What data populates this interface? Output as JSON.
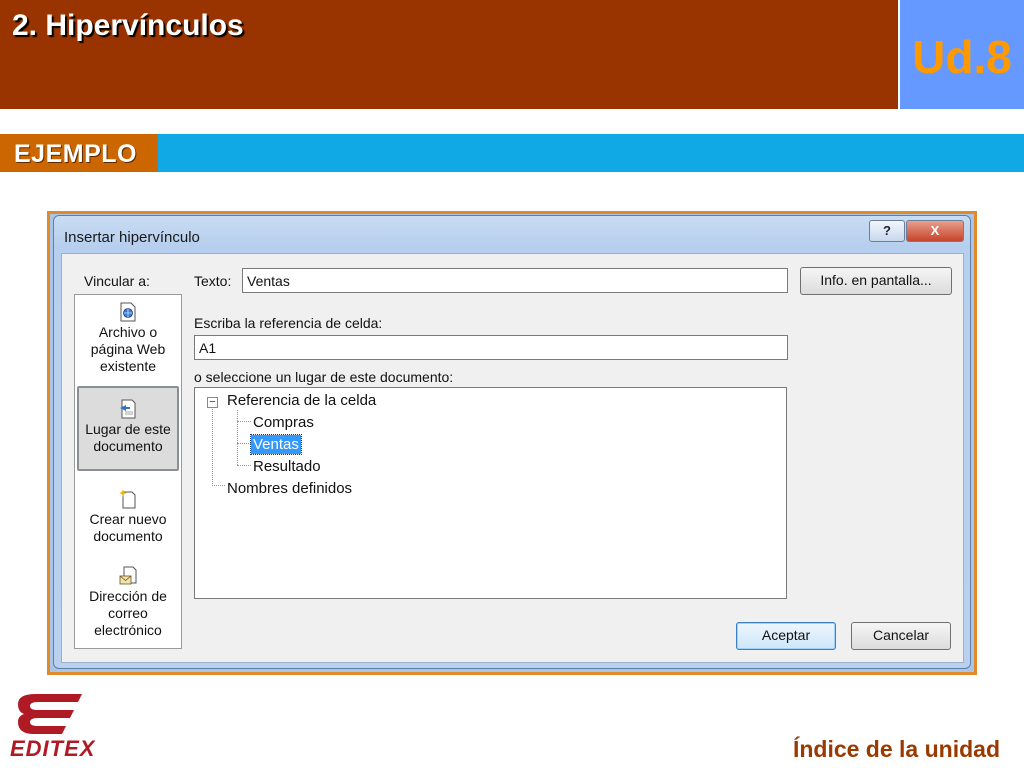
{
  "header": {
    "title": "2. Hipervínculos",
    "unit": "Ud.8"
  },
  "section": {
    "label": "EJEMPLO"
  },
  "dialog": {
    "title": "Insertar hipervínculo",
    "help_label": "?",
    "close_label": "X",
    "link_to_label": "Vincular a:",
    "nav_items": [
      {
        "label_lines": [
          "Archivo o",
          "página Web",
          "existente"
        ],
        "icon": "web-page-file-icon"
      },
      {
        "label_lines": [
          "Lugar de este",
          "documento"
        ],
        "icon": "document-place-icon",
        "selected": true
      },
      {
        "label_lines": [
          "Crear nuevo",
          "documento"
        ],
        "icon": "new-document-icon"
      },
      {
        "label_lines": [
          "Dirección de",
          "correo",
          "electrónico"
        ],
        "icon": "email-icon"
      }
    ],
    "text_label": "Texto:",
    "text_value": "Ventas",
    "screentip_button": "Info. en pantalla...",
    "cell_ref_label": "Escriba la referencia de celda:",
    "cell_ref_value": "A1",
    "place_label": "o seleccione un lugar de este documento:",
    "tree": {
      "root": "Referencia de la celda",
      "expander": "−",
      "children": [
        "Compras",
        "Ventas",
        "Resultado"
      ],
      "selected": "Ventas",
      "second_root": "Nombres definidos"
    },
    "ok_button": "Aceptar",
    "cancel_button": "Cancelar"
  },
  "footer": {
    "logo_text": "EDITEX",
    "index_link": "Índice de la unidad"
  },
  "colors": {
    "header_brown": "#993300",
    "unit_blue": "#6699ff",
    "unit_orange": "#ff9900",
    "ejemplo_orange": "#cc6600",
    "ejemplo_band_blue": "#11a8e6",
    "frame_orange": "#e08a2a",
    "logo_red": "#b01a24",
    "selection_blue": "#3399ff"
  }
}
